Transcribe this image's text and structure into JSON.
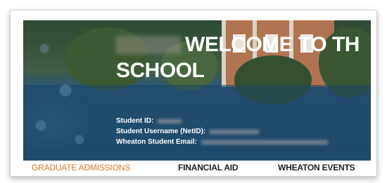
{
  "hero": {
    "welcome_line1": "WELCOME TO TH",
    "welcome_line2": "SCHOOL",
    "student_id_label": "Student ID:",
    "username_label": "Student Username (NetID):",
    "email_label": "Wheaton Student Email:"
  },
  "nav": {
    "items": [
      {
        "label": "GRADUATE ADMISSIONS",
        "color": "#e0762a"
      },
      {
        "label": "FINANCIAL AID",
        "color": "#1e1e1e"
      },
      {
        "label": "WHEATON EVENTS",
        "color": "#1e1e1e"
      }
    ]
  },
  "colors": {
    "accent": "#e0762a",
    "overlay": "#1c4664",
    "text_light": "#ffffff"
  }
}
